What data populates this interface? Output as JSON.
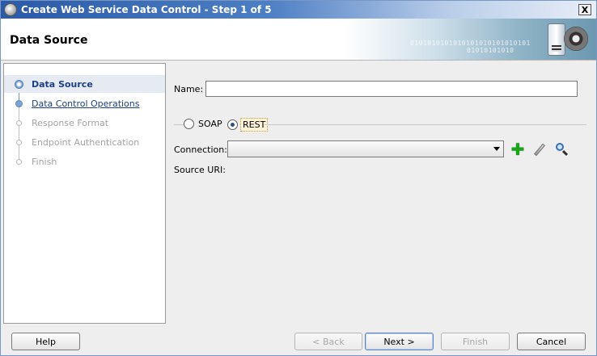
{
  "window": {
    "title": "Create Web Service Data Control - Step 1 of 5",
    "close_glyph": "X"
  },
  "banner": {
    "title": "Data Source",
    "binary_art_1": "0101010101010101010101010101",
    "binary_art_2": "01010101010"
  },
  "train": {
    "steps": [
      {
        "label": "Data Source",
        "state": "current"
      },
      {
        "label": "Data Control Operations",
        "state": "visited"
      },
      {
        "label": "Response Format",
        "state": "disabled"
      },
      {
        "label": "Endpoint Authentication",
        "state": "disabled"
      },
      {
        "label": "Finish",
        "state": "disabled"
      }
    ]
  },
  "form": {
    "name_label": "Name:",
    "name_value": "",
    "soap_label": "SOAP",
    "rest_label": "REST",
    "selected_protocol": "REST",
    "connection_label": "Connection:",
    "connection_value": "",
    "source_uri_label": "Source URI:"
  },
  "buttons": {
    "help": "Help",
    "back": "< Back",
    "next": "Next >",
    "finish": "Finish",
    "cancel": "Cancel"
  },
  "colors": {
    "title_bar": "#2a5aa8",
    "link_blue": "#1d3f84",
    "add_green": "#1aa31a"
  }
}
